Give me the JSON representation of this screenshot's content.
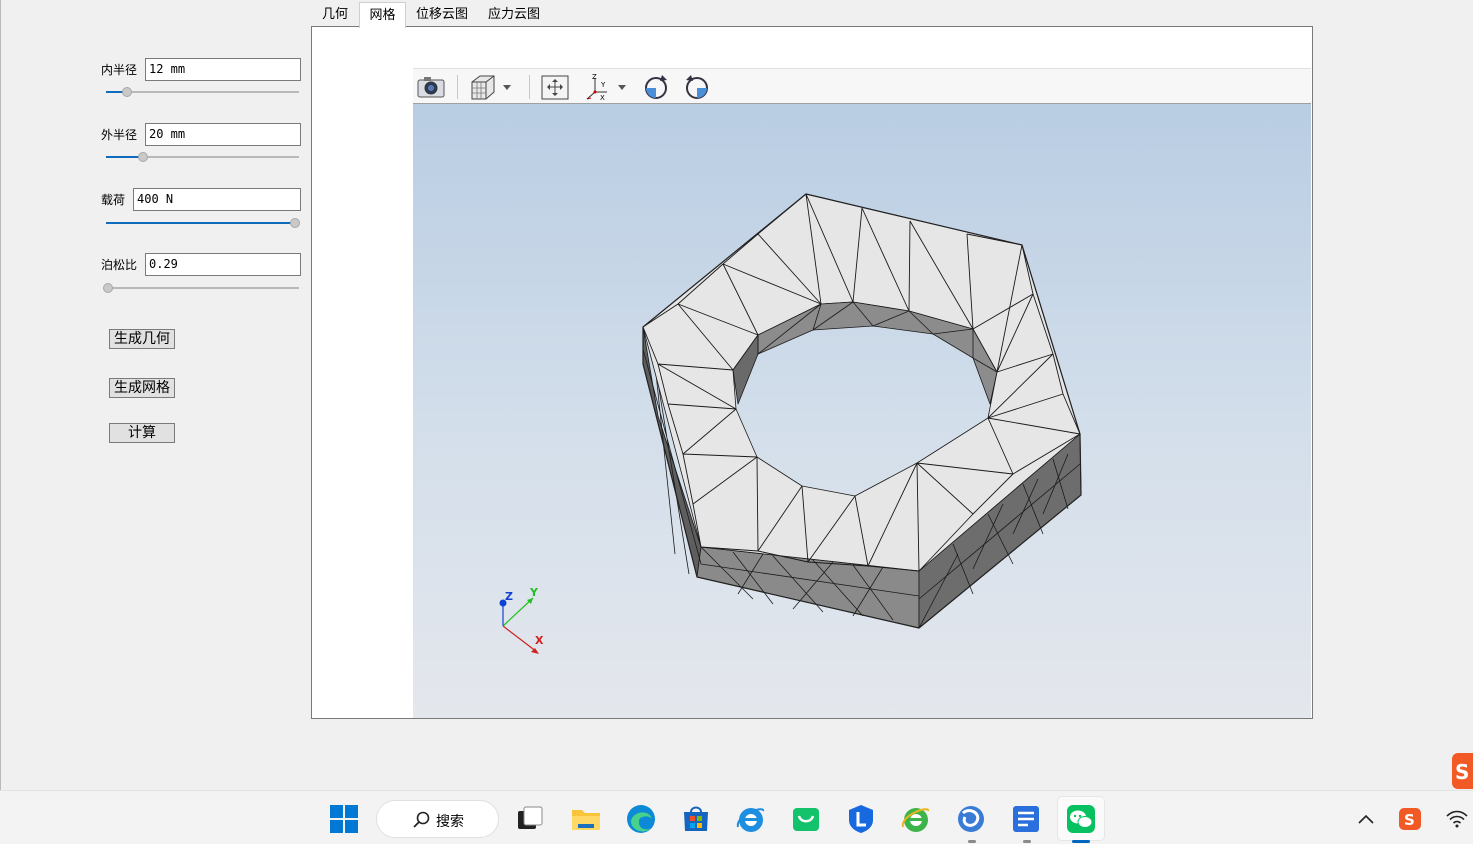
{
  "params": [
    {
      "label": "内半径",
      "value": "12 mm",
      "slider_pct": 0.11
    },
    {
      "label": "外半径",
      "value": "20 mm",
      "slider_pct": 0.19
    },
    {
      "label": "载荷",
      "value": "400 N",
      "slider_pct": 1.0
    },
    {
      "label": "泊松比",
      "value": "0.29",
      "slider_pct": 0.0
    }
  ],
  "buttons": {
    "gen_geometry": "生成几何",
    "gen_mesh": "生成网格",
    "compute": "计算"
  },
  "tabs": [
    {
      "label": "几何",
      "active": false
    },
    {
      "label": "网格",
      "active": true
    },
    {
      "label": "位移云图",
      "active": false
    },
    {
      "label": "应力云图",
      "active": false
    }
  ],
  "viewer_toolbar": [
    "camera-icon",
    "view-cube-icon",
    "fit-all-icon",
    "axes-view-icon",
    "rotate-ccw-icon",
    "rotate-cw-icon"
  ],
  "triad": {
    "z": "Z",
    "y": "Y",
    "x": "X"
  },
  "taskbar": {
    "search_label": "搜索",
    "apps": [
      "windows-start-icon",
      "search-icon",
      "task-view-icon",
      "file-explorer-icon",
      "edge-icon",
      "store-icon",
      "ie-icon",
      "wechat-app-icon",
      "l-app-icon",
      "ie-green-icon",
      "browser-app-icon",
      "editor-app-icon",
      "wechat-icon"
    ]
  },
  "colors": {
    "accent": "#0f6cbd",
    "mesh_top": "#e4e4e4",
    "mesh_side": "#7a7a7a",
    "mesh_inner": "#8c8c8c"
  }
}
